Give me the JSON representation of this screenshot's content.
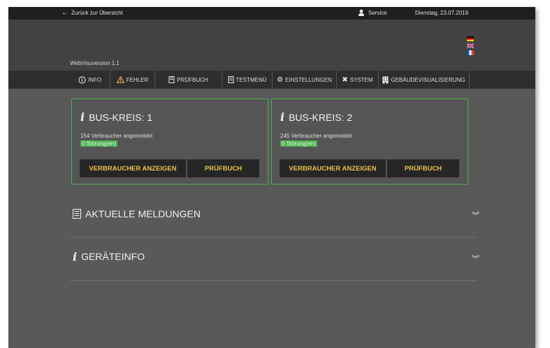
{
  "topbar": {
    "back_label": "Zurück zur Übersicht",
    "service_label": "Service",
    "date": "Dienstag, 23.07.2019"
  },
  "header": {
    "version": "WebVisuversion 1.1"
  },
  "nav": {
    "info": "INFO",
    "fehler": "FEHLER",
    "pruefbuch": "PRÜFBUCH",
    "testmenue": "TESTMENÜ",
    "einstellungen": "EINSTELLUNGEN",
    "system": "SYSTEM",
    "gebaeude": "GEBÄUDEVISUALISIERUNG"
  },
  "cards": [
    {
      "title": "BUS-KREIS: 1",
      "count": "154 Verbraucher angemeldet",
      "faults": "0 Störung(en)",
      "btn_consumers": "VERBRAUCHER ANZEIGEN",
      "btn_log": "PRÜFBUCH"
    },
    {
      "title": "BUS-KREIS: 2",
      "count": "245 Verbraucher angemeldet",
      "faults": "0 Störung(en)",
      "btn_consumers": "VERBRAUCHER ANZEIGEN",
      "btn_log": "PRÜFBUCH"
    }
  ],
  "sections": {
    "messages": "AKTUELLE MELDUNGEN",
    "device": "GERÄTEINFO"
  },
  "colors": {
    "accent_green": "#4caf50",
    "button_text": "#e7c24a"
  }
}
